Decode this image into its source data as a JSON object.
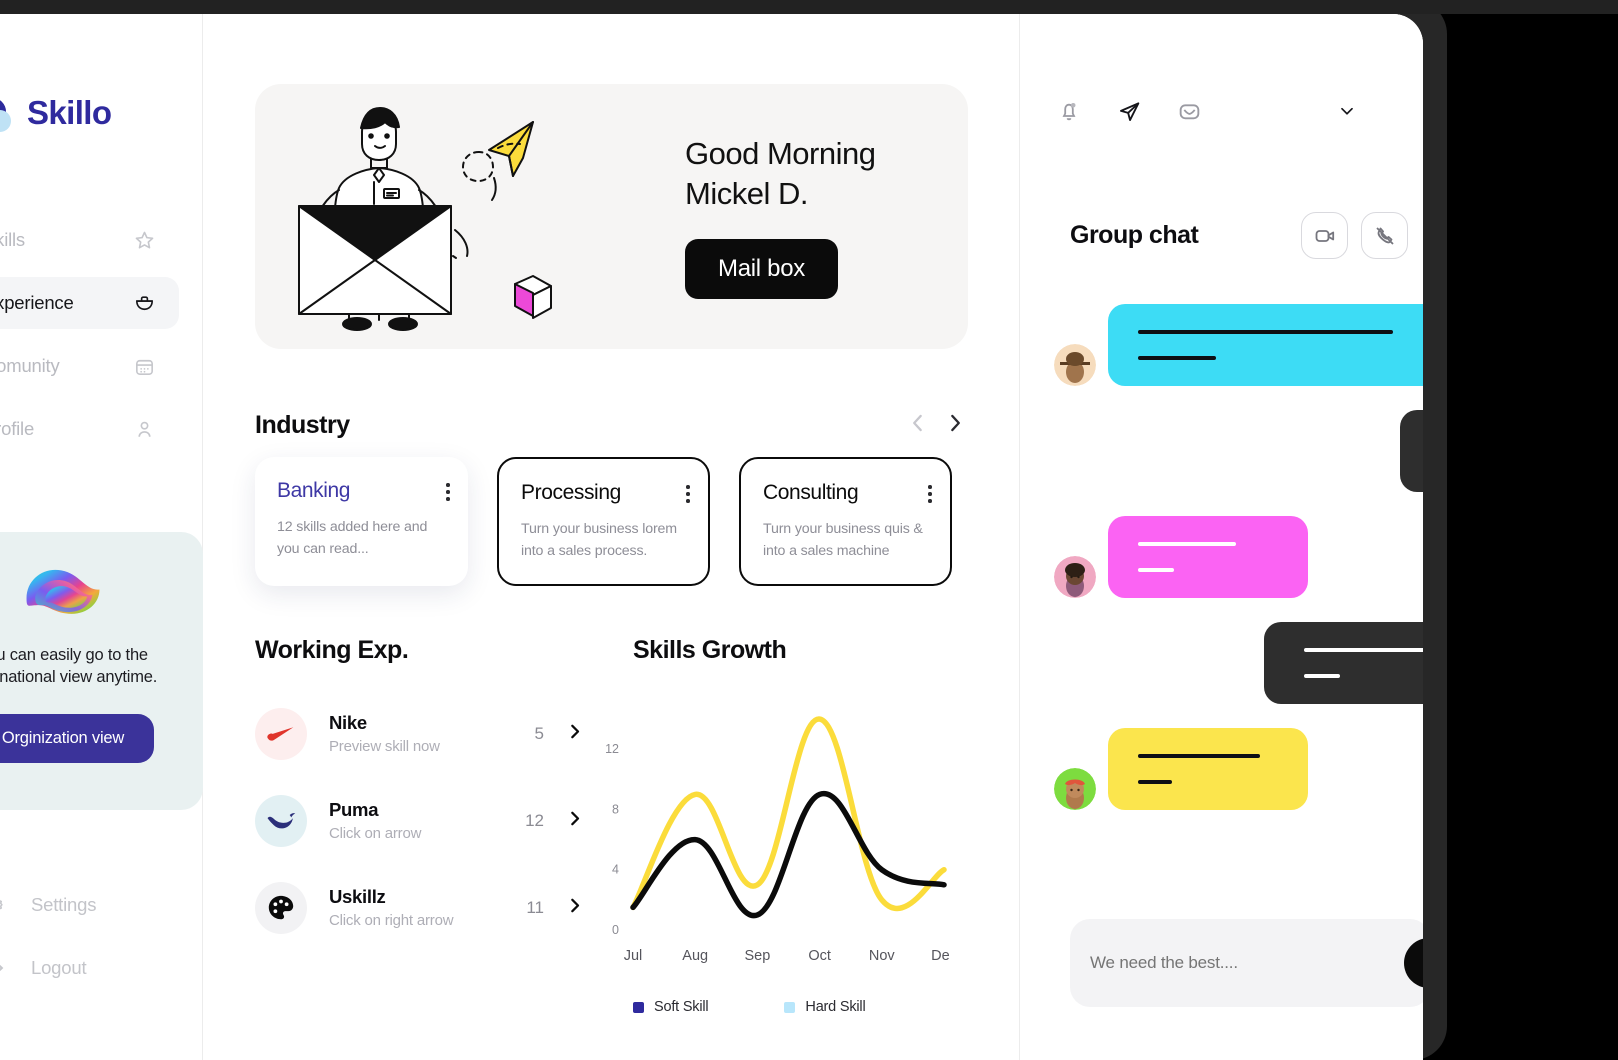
{
  "brand": {
    "name": "Skillo"
  },
  "sidebar": {
    "items": [
      {
        "label": "Skills",
        "icon": "star-icon",
        "active": false
      },
      {
        "label": "Experience",
        "icon": "briefcase-icon",
        "active": true
      },
      {
        "label": "Comunity",
        "icon": "calendar-icon",
        "active": false
      },
      {
        "label": "Profile",
        "icon": "person-icon",
        "active": false
      }
    ],
    "promo": {
      "text": "You can easily go to the ouginational view anytime.",
      "button_label": "Orginization view",
      "bg": "#e9f1f1",
      "button_bg": "#3b339a"
    },
    "bottom_items": [
      {
        "label": "Settings",
        "icon": "gear-icon"
      },
      {
        "label": "Logout",
        "icon": "logout-icon"
      }
    ]
  },
  "hero": {
    "greeting_line1": "Good Morning",
    "greeting_line2": "Mickel D.",
    "button_label": "Mail box",
    "bg": "#f6f5f4"
  },
  "industry": {
    "title": "Industry",
    "prev_icon": "chevron-left-icon",
    "next_icon": "chevron-right-icon",
    "cards": [
      {
        "title": "Banking",
        "desc": "12 skills added here and you can read...",
        "style": "soft",
        "title_color": "#3e38a5"
      },
      {
        "title": "Processing",
        "desc": "Turn your business lorem into a sales process.",
        "style": "outlined",
        "title_color": "#0b0b0b"
      },
      {
        "title": "Consulting",
        "desc": "Turn your business quis & into a sales machine",
        "style": "outlined",
        "title_color": "#0b0b0b"
      }
    ]
  },
  "working_exp": {
    "title": "Working Exp.",
    "rows": [
      {
        "name": "Nike",
        "sub": "Preview skill now",
        "count": "5",
        "logo": "nike-swoosh-logo",
        "logo_bg": "#fdeeee",
        "logo_color": "#e0342b"
      },
      {
        "name": "Puma",
        "sub": "Click on arrow",
        "count": "12",
        "logo": "puma-logo",
        "logo_bg": "#e2f0f3",
        "logo_color": "#2b2f7a"
      },
      {
        "name": "Uskillz",
        "sub": "Click on right arrow",
        "count": "11",
        "logo": "palette-logo",
        "logo_bg": "#f2f2f4",
        "logo_color": "#0b0b0b"
      }
    ]
  },
  "chart_data": {
    "type": "line",
    "title": "Skills Growth",
    "xlabel": "",
    "ylabel": "",
    "categories": [
      "Jul",
      "Aug",
      "Sep",
      "Oct",
      "Nov",
      "Dec"
    ],
    "ytick_labels": [
      "12",
      "8",
      "4",
      "0"
    ],
    "ylim": [
      0,
      15
    ],
    "grid": false,
    "legend_position": "bottom",
    "series": [
      {
        "name": "Hard Skill",
        "color": "#fbdc3b",
        "legend_swatch": "#b8e6fb",
        "values": [
          1.5,
          9.0,
          3.0,
          14.0,
          2.0,
          4.0
        ]
      },
      {
        "name": "Soft Skill",
        "color": "#0b0b0b",
        "legend_swatch": "#2f2a9e",
        "values": [
          1.5,
          6.0,
          1.0,
          9.0,
          4.0,
          3.0
        ]
      }
    ],
    "legend": [
      {
        "label": "Soft Skill",
        "color": "#2f2a9e"
      },
      {
        "label": "Hard Skill",
        "color": "#b8e6fb"
      }
    ]
  },
  "chat": {
    "topbar_icons": [
      {
        "name": "bell-icon"
      },
      {
        "name": "paper-plane-icon"
      },
      {
        "name": "envelope-icon"
      },
      {
        "name": "chevron-down-icon"
      }
    ],
    "title": "Group chat",
    "video_call_icon": "video-camera-icon",
    "voice_call_icon": "phone-icon",
    "messages": [
      {
        "side": "left",
        "color": "#3ddcf5",
        "avatar": "hat-avatar",
        "avatar_bg": "#f5d8b6"
      },
      {
        "side": "right",
        "color": "#2e2e2e",
        "avatar": null,
        "avatar_bg": null
      },
      {
        "side": "left",
        "color": "#fb63f3",
        "avatar": "curly-avatar",
        "avatar_bg": "#f0a8c2"
      },
      {
        "side": "right",
        "color": "#2e2e2e",
        "avatar": null,
        "avatar_bg": null
      },
      {
        "side": "left",
        "color": "#fbe54d",
        "avatar": "redhair-avatar",
        "avatar_bg": "#7ddc3f"
      }
    ],
    "composer": {
      "placeholder": "We need the best....",
      "value": "",
      "send_icon": "chevron-right-icon"
    }
  }
}
